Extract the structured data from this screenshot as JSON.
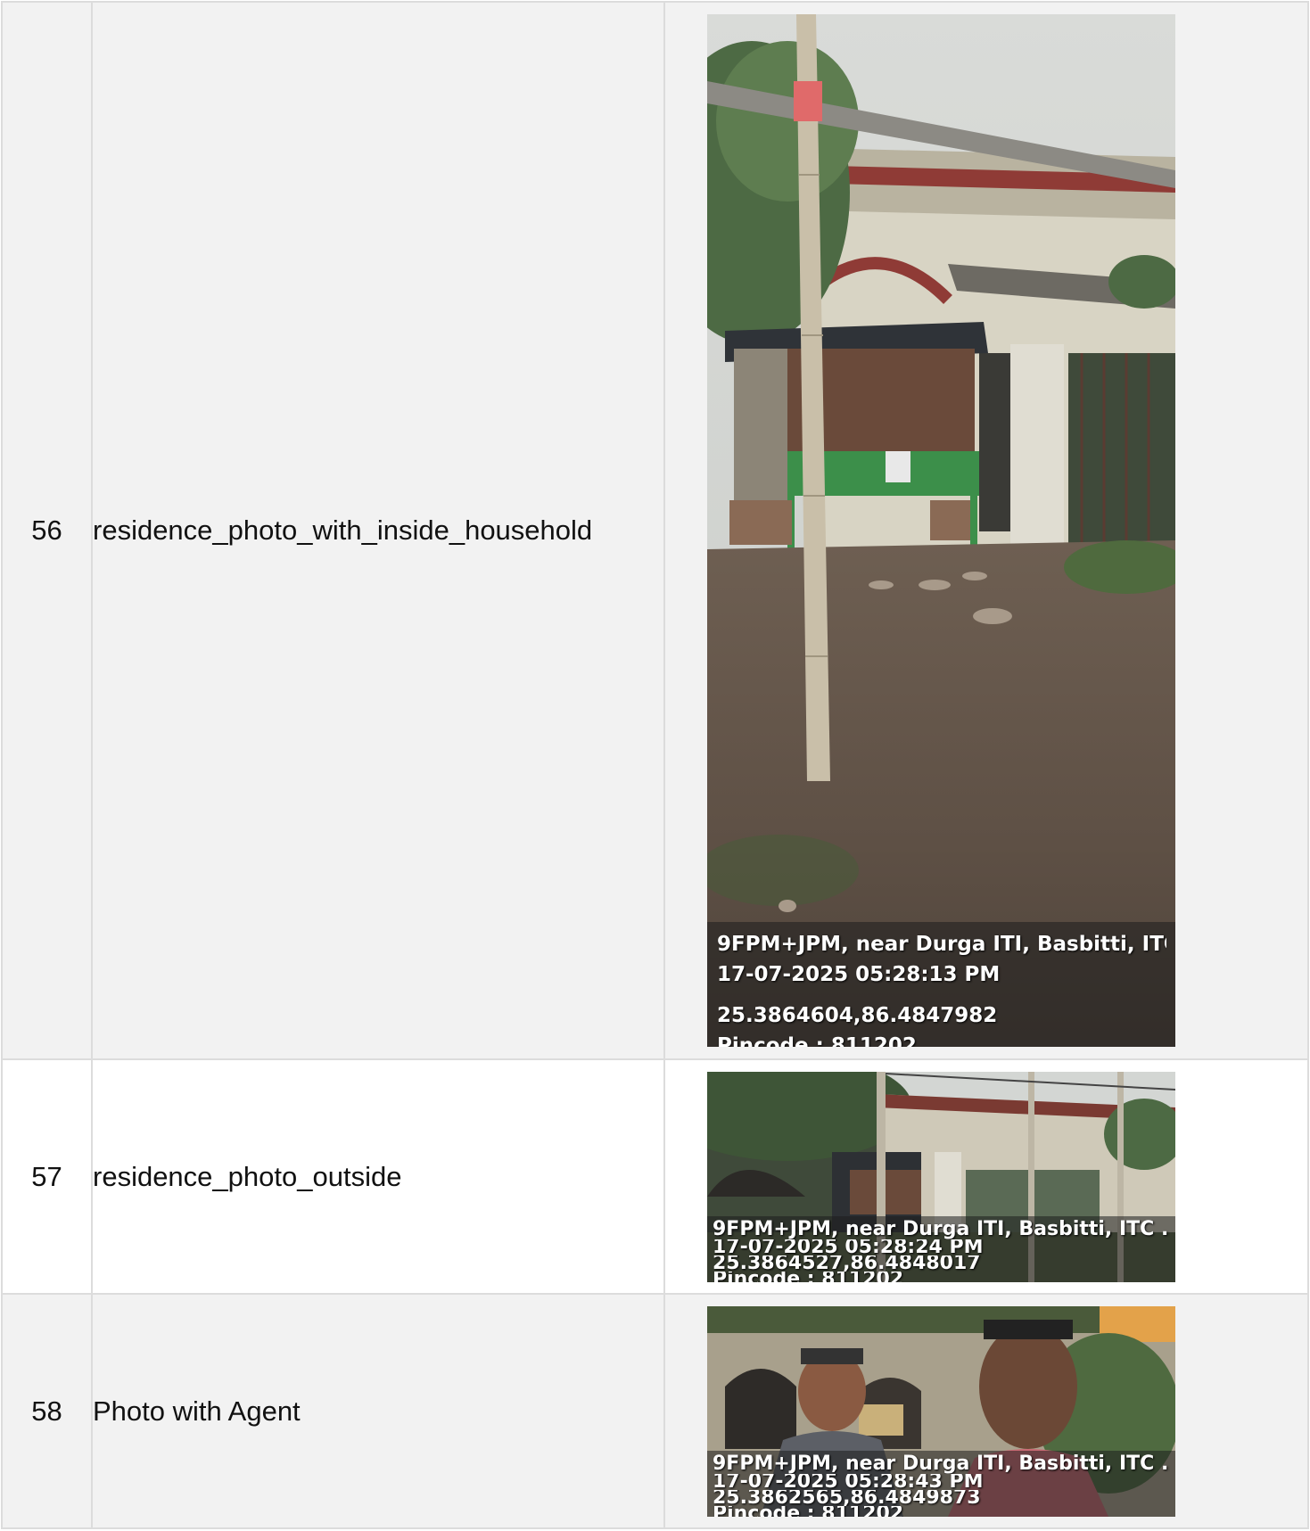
{
  "rows": [
    {
      "number": "56",
      "label": "residence_photo_with_inside_household",
      "photo": {
        "scene": "courtyard with bamboo pole, old building and green kiosk",
        "stamp": {
          "address": "9FPM+JPM, near Durga ITI, Basbitti, ITC ...",
          "datetime": "17-07-2025 05:28:13 PM",
          "coordinates": "25.3864604,86.4847982",
          "pincode": "Pincode : 811202"
        }
      }
    },
    {
      "number": "57",
      "label": "residence_photo_outside",
      "photo": {
        "scene": "outside view of old building with bamboo poles",
        "stamp": {
          "address": "9FPM+JPM, near Durga ITI, Basbitti, ITC ...",
          "datetime": "17-07-2025 05:28:24 PM",
          "coordinates": "25.3864527,86.4848017",
          "pincode": "Pincode : 811202"
        }
      }
    },
    {
      "number": "58",
      "label": "Photo with Agent",
      "photo": {
        "scene": "selfie of two men in front of old arched building",
        "stamp": {
          "address": "9FPM+JPM, near Durga ITI, Basbitti, ITC ...",
          "datetime": "17-07-2025 05:28:43 PM",
          "coordinates": "25.3862565,86.4849873",
          "pincode": "Pincode : 811202"
        }
      }
    }
  ],
  "colors": {
    "shaded_row": "#f2f2f2",
    "plain_row": "#ffffff",
    "border": "#dcdcdc"
  }
}
